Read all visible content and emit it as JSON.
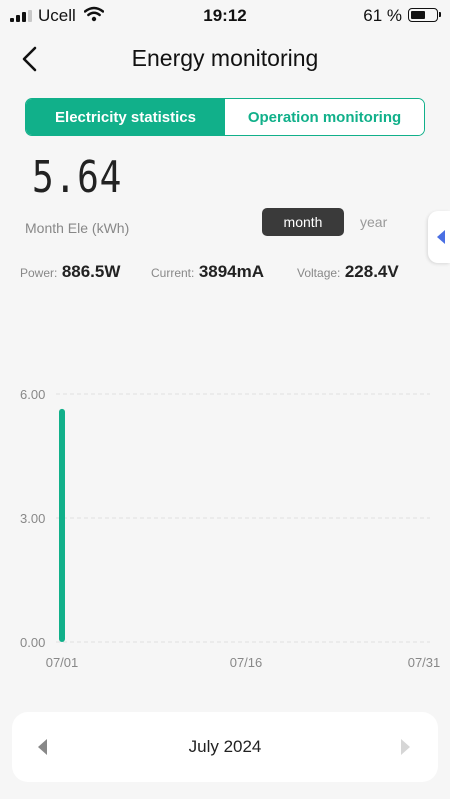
{
  "status_bar": {
    "carrier": "Ucell",
    "time": "19:12",
    "battery_percent": "61 %",
    "battery_level": 0.61
  },
  "header": {
    "title": "Energy monitoring"
  },
  "tabs": [
    {
      "label": "Electricity statistics",
      "active": true
    },
    {
      "label": "Operation monitoring",
      "active": false
    }
  ],
  "summary": {
    "value": "5.64",
    "label": "Month Ele (kWh)",
    "period_month": "month",
    "period_year": "year"
  },
  "metrics": {
    "power": {
      "label": "Power:",
      "value": "886.5W"
    },
    "current": {
      "label": "Current:",
      "value": "3894mA"
    },
    "voltage": {
      "label": "Voltage:",
      "value": "228.4V"
    }
  },
  "chart_data": {
    "type": "bar",
    "x_tick_labels": [
      "07/01",
      "07/16",
      "07/31"
    ],
    "y_tick_labels": [
      "0.00",
      "3.00",
      "6.00"
    ],
    "ylim": [
      0,
      6
    ],
    "x_range": [
      1,
      31
    ],
    "bars": [
      {
        "day": 1,
        "value": 5.64
      }
    ],
    "bar_color": "#11b08a",
    "grid": true
  },
  "month_nav": {
    "label": "July 2024"
  },
  "colors": {
    "accent": "#11b08a",
    "dark_button": "#3a3a3a",
    "handle_arrow": "#4a6fe3"
  }
}
